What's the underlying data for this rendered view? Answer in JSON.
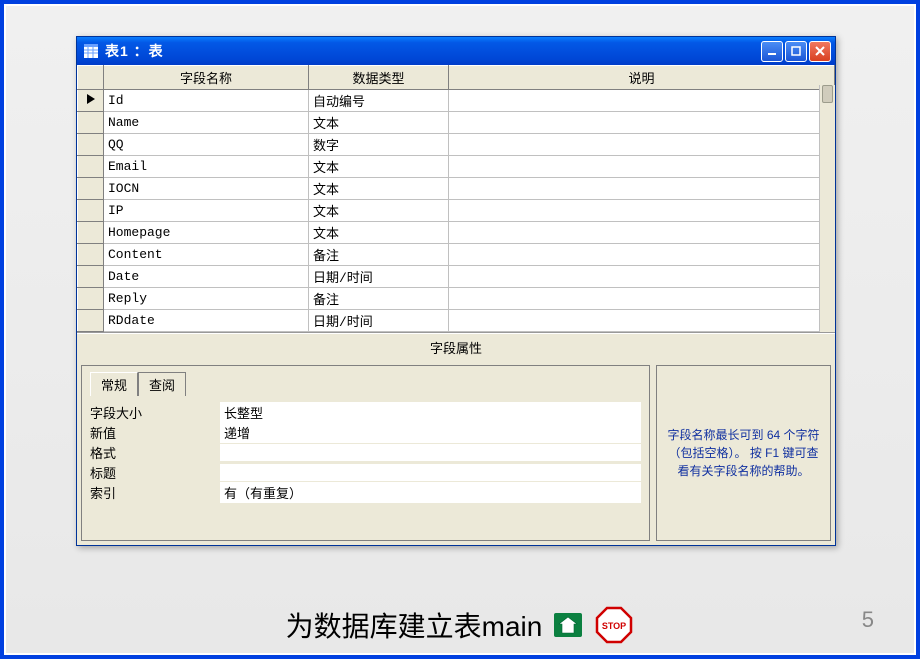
{
  "window": {
    "title": "表1 ：表",
    "controls": {
      "min": "_",
      "max": "□",
      "close": "×"
    }
  },
  "grid": {
    "headers": {
      "name": "字段名称",
      "type": "数据类型",
      "desc": "说明"
    },
    "rows": [
      {
        "name": "Id",
        "type": "自动编号",
        "desc": "",
        "current": true
      },
      {
        "name": "Name",
        "type": "文本",
        "desc": ""
      },
      {
        "name": "QQ",
        "type": "数字",
        "desc": ""
      },
      {
        "name": "Email",
        "type": "文本",
        "desc": ""
      },
      {
        "name": "IOCN",
        "type": "文本",
        "desc": ""
      },
      {
        "name": "IP",
        "type": "文本",
        "desc": ""
      },
      {
        "name": "Homepage",
        "type": "文本",
        "desc": ""
      },
      {
        "name": "Content",
        "type": "备注",
        "desc": ""
      },
      {
        "name": "Date",
        "type": "日期/时间",
        "desc": ""
      },
      {
        "name": "Reply",
        "type": "备注",
        "desc": ""
      },
      {
        "name": "RDdate",
        "type": "日期/时间",
        "desc": ""
      }
    ]
  },
  "section_label": "字段属性",
  "tabs": {
    "general": "常规",
    "lookup": "查阅"
  },
  "props": {
    "field_size": {
      "label": "字段大小",
      "value": "长整型"
    },
    "new_value": {
      "label": "新值",
      "value": "递增"
    },
    "format": {
      "label": "格式",
      "value": ""
    },
    "caption": {
      "label": "标题",
      "value": ""
    },
    "indexed": {
      "label": "索引",
      "value": "有（有重复）"
    }
  },
  "help_text": "字段名称最长可到 64 个字符（包括空格）。 按 F1 键可查看有关字段名称的帮助。",
  "footer_caption": "为数据库建立表main",
  "stop_label": "STOP",
  "page_number": "5"
}
